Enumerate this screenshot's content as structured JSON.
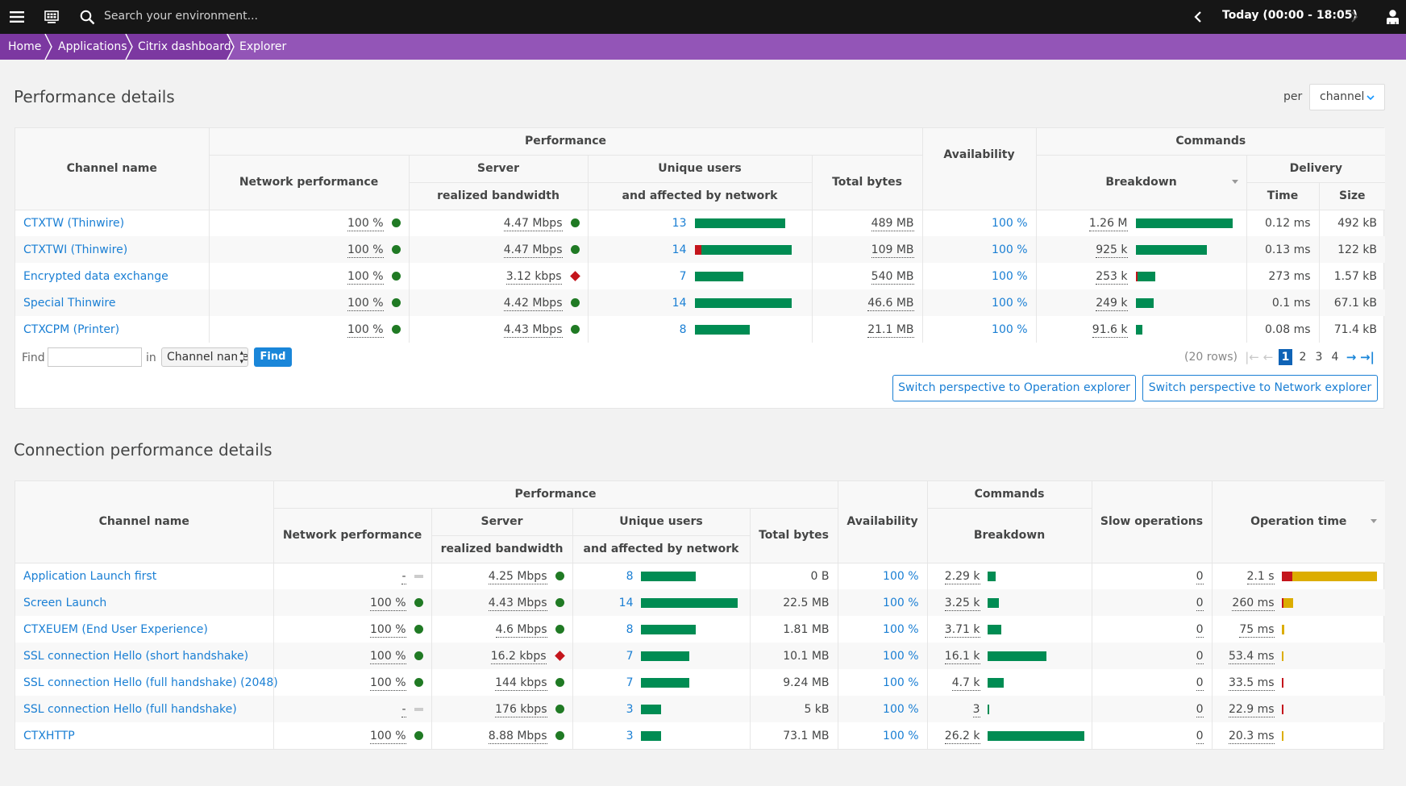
{
  "topbar": {
    "menu_icon": "hamburger-icon",
    "apps_icon": "dashboard-grid-icon",
    "search_icon": "search-icon",
    "search_placeholder": "Search your environment...",
    "prev_icon": "chevron-left-icon",
    "timeframe": "Today (00:00 - 18:05)",
    "next_icon": "chevron-right-icon",
    "user_icon": "user-icon"
  },
  "breadcrumb": [
    "Home",
    "Applications",
    "Citrix dashboard",
    "Explorer"
  ],
  "section1": {
    "title": "Performance details",
    "per_label": "per",
    "per_value": "channel",
    "headers": {
      "channel_name": "Channel name",
      "performance": "Performance",
      "network_performance": "Network performance",
      "server": "Server",
      "realized_bandwidth": "realized bandwidth",
      "unique_users": "Unique users",
      "affected_by_network": "and affected by network",
      "total_bytes": "Total bytes",
      "availability": "Availability",
      "commands": "Commands",
      "breakdown": "Breakdown",
      "delivery": "Delivery",
      "time": "Time",
      "size": "Size"
    },
    "rows": [
      {
        "name": "CTXTW (Thinwire)",
        "net": "100 %",
        "net_status": "ok",
        "bw": "4.47 Mbps",
        "bw_status": "ok",
        "users": "13",
        "users_frac": 0.93,
        "users_bad_frac": 0,
        "bytes": "489 MB",
        "avail": "100 %",
        "cmds": "1.26 M",
        "cmds_frac": 1.0,
        "cmds_bad_frac": 0,
        "time": "0.12 ms",
        "size": "492 kB"
      },
      {
        "name": "CTXTWI (Thinwire)",
        "net": "100 %",
        "net_status": "ok",
        "bw": "4.47 Mbps",
        "bw_status": "ok",
        "users": "14",
        "users_frac": 1.0,
        "users_bad_frac": 0.07,
        "bytes": "109 MB",
        "avail": "100 %",
        "cmds": "925 k",
        "cmds_frac": 0.73,
        "cmds_bad_frac": 0,
        "time": "0.13 ms",
        "size": "122 kB"
      },
      {
        "name": "Encrypted data exchange",
        "net": "100 %",
        "net_status": "ok",
        "bw": "3.12 kbps",
        "bw_status": "bad",
        "users": "7",
        "users_frac": 0.5,
        "users_bad_frac": 0,
        "bytes": "540 MB",
        "avail": "100 %",
        "cmds": "253 k",
        "cmds_frac": 0.2,
        "cmds_bad_frac": 0.08,
        "time": "273 ms",
        "size": "1.57 kB"
      },
      {
        "name": "Special Thinwire",
        "net": "100 %",
        "net_status": "ok",
        "bw": "4.42 Mbps",
        "bw_status": "ok",
        "users": "14",
        "users_frac": 1.0,
        "users_bad_frac": 0,
        "bytes": "46.6 MB",
        "avail": "100 %",
        "cmds": "249 k",
        "cmds_frac": 0.18,
        "cmds_bad_frac": 0,
        "time": "0.1 ms",
        "size": "67.1 kB"
      },
      {
        "name": "CTXCPM (Printer)",
        "net": "100 %",
        "net_status": "ok",
        "bw": "4.43 Mbps",
        "bw_status": "ok",
        "users": "8",
        "users_frac": 0.57,
        "users_bad_frac": 0,
        "bytes": "21.1 MB",
        "avail": "100 %",
        "cmds": "91.6 k",
        "cmds_frac": 0.07,
        "cmds_bad_frac": 0,
        "time": "0.08 ms",
        "size": "71.4 kB"
      }
    ],
    "find": {
      "label": "Find",
      "value": "",
      "in_label": "in",
      "field": "Channel name",
      "button": "Find"
    },
    "pager": {
      "rows": "(20 rows)",
      "pages": [
        "1",
        "2",
        "3",
        "4"
      ],
      "current": "1"
    },
    "buttons": {
      "operation_explorer": "Switch perspective to Operation explorer",
      "network_explorer": "Switch perspective to Network explorer"
    }
  },
  "section2": {
    "title": "Connection performance details",
    "headers": {
      "channel_name": "Channel name",
      "performance": "Performance",
      "network_performance": "Network performance",
      "server": "Server",
      "realized_bandwidth": "realized bandwidth",
      "unique_users": "Unique users",
      "affected_by_network": "and affected by network",
      "total_bytes": "Total bytes",
      "availability": "Availability",
      "commands": "Commands",
      "breakdown": "Breakdown",
      "slow_operations": "Slow operations",
      "operation_time": "Operation time"
    },
    "rows": [
      {
        "name": "Application Launch first",
        "net": "-",
        "net_status": "none",
        "bw": "4.25 Mbps",
        "bw_status": "ok",
        "users": "8",
        "users_frac": 0.57,
        "bytes": "0 B",
        "avail": "100 %",
        "cmds": "2.29 k",
        "cmds_frac": 0.08,
        "slow": "0",
        "optime": "2.1 s",
        "op_frac": 1.0,
        "op_bad_frac": 0.11
      },
      {
        "name": "Screen Launch",
        "net": "100 %",
        "net_status": "ok",
        "bw": "4.43 Mbps",
        "bw_status": "ok",
        "users": "14",
        "users_frac": 1.0,
        "bytes": "22.5 MB",
        "avail": "100 %",
        "cmds": "3.25 k",
        "cmds_frac": 0.12,
        "slow": "0",
        "optime": "260 ms",
        "op_frac": 0.12,
        "op_bad_frac": 0.02
      },
      {
        "name": "CTXEUEM (End User Experience)",
        "net": "100 %",
        "net_status": "ok",
        "bw": "4.6 Mbps",
        "bw_status": "ok",
        "users": "8",
        "users_frac": 0.57,
        "bytes": "1.81 MB",
        "avail": "100 %",
        "cmds": "3.71 k",
        "cmds_frac": 0.14,
        "slow": "0",
        "optime": "75 ms",
        "op_frac": 0.025,
        "op_bad_frac": 0
      },
      {
        "name": "SSL connection Hello (short handshake)",
        "net": "100 %",
        "net_status": "ok",
        "bw": "16.2 kbps",
        "bw_status": "bad",
        "users": "7",
        "users_frac": 0.5,
        "bytes": "10.1 MB",
        "avail": "100 %",
        "cmds": "16.1 k",
        "cmds_frac": 0.61,
        "slow": "0",
        "optime": "53.4 ms",
        "op_frac": 0.018,
        "op_bad_frac": 0
      },
      {
        "name": "SSL connection Hello (full handshake) (2048)",
        "net": "100 %",
        "net_status": "ok",
        "bw": "144 kbps",
        "bw_status": "ok",
        "users": "7",
        "users_frac": 0.5,
        "bytes": "9.24 MB",
        "avail": "100 %",
        "cmds": "4.7 k",
        "cmds_frac": 0.17,
        "slow": "0",
        "optime": "33.5 ms",
        "op_frac": 0.012,
        "op_bad_frac": 1.0
      },
      {
        "name": "SSL connection Hello (full handshake)",
        "net": "-",
        "net_status": "none",
        "bw": "176 kbps",
        "bw_status": "ok",
        "users": "3",
        "users_frac": 0.21,
        "bytes": "5 kB",
        "avail": "100 %",
        "cmds": "3",
        "cmds_frac": 0.01,
        "slow": "0",
        "optime": "22.9 ms",
        "op_frac": 0.01,
        "op_bad_frac": 1.0
      },
      {
        "name": "CTXHTTP",
        "net": "100 %",
        "net_status": "ok",
        "bw": "8.88 Mbps",
        "bw_status": "ok",
        "users": "3",
        "users_frac": 0.21,
        "bytes": "73.1 MB",
        "avail": "100 %",
        "cmds": "26.2 k",
        "cmds_frac": 1.0,
        "slow": "0",
        "optime": "20.3 ms",
        "op_frac": 0.01,
        "op_bad_frac": 0
      }
    ]
  },
  "colors": {
    "topbar": "#161616",
    "breadcrumb": "#9355b7",
    "breadcrumb_active": "#7c38a1",
    "ok": "#207a24",
    "bad": "#c4151c",
    "bar_good": "#008c53",
    "bar_warn": "#dcad00",
    "link": "#1a7fd4"
  }
}
